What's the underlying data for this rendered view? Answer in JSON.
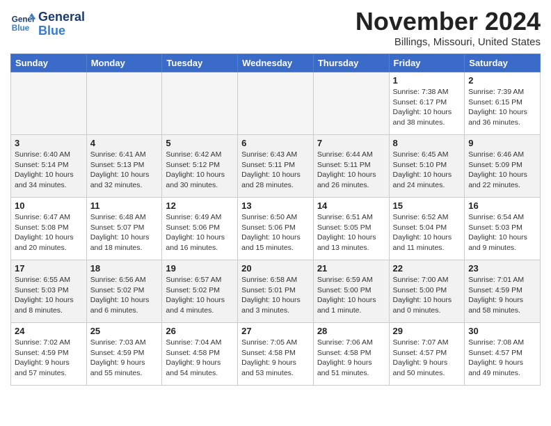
{
  "header": {
    "logo_line1": "General",
    "logo_line2": "Blue",
    "month": "November 2024",
    "location": "Billings, Missouri, United States"
  },
  "weekdays": [
    "Sunday",
    "Monday",
    "Tuesday",
    "Wednesday",
    "Thursday",
    "Friday",
    "Saturday"
  ],
  "weeks": [
    [
      {
        "day": "",
        "info": ""
      },
      {
        "day": "",
        "info": ""
      },
      {
        "day": "",
        "info": ""
      },
      {
        "day": "",
        "info": ""
      },
      {
        "day": "",
        "info": ""
      },
      {
        "day": "1",
        "info": "Sunrise: 7:38 AM\nSunset: 6:17 PM\nDaylight: 10 hours and 38 minutes."
      },
      {
        "day": "2",
        "info": "Sunrise: 7:39 AM\nSunset: 6:15 PM\nDaylight: 10 hours and 36 minutes."
      }
    ],
    [
      {
        "day": "3",
        "info": "Sunrise: 6:40 AM\nSunset: 5:14 PM\nDaylight: 10 hours and 34 minutes."
      },
      {
        "day": "4",
        "info": "Sunrise: 6:41 AM\nSunset: 5:13 PM\nDaylight: 10 hours and 32 minutes."
      },
      {
        "day": "5",
        "info": "Sunrise: 6:42 AM\nSunset: 5:12 PM\nDaylight: 10 hours and 30 minutes."
      },
      {
        "day": "6",
        "info": "Sunrise: 6:43 AM\nSunset: 5:11 PM\nDaylight: 10 hours and 28 minutes."
      },
      {
        "day": "7",
        "info": "Sunrise: 6:44 AM\nSunset: 5:11 PM\nDaylight: 10 hours and 26 minutes."
      },
      {
        "day": "8",
        "info": "Sunrise: 6:45 AM\nSunset: 5:10 PM\nDaylight: 10 hours and 24 minutes."
      },
      {
        "day": "9",
        "info": "Sunrise: 6:46 AM\nSunset: 5:09 PM\nDaylight: 10 hours and 22 minutes."
      }
    ],
    [
      {
        "day": "10",
        "info": "Sunrise: 6:47 AM\nSunset: 5:08 PM\nDaylight: 10 hours and 20 minutes."
      },
      {
        "day": "11",
        "info": "Sunrise: 6:48 AM\nSunset: 5:07 PM\nDaylight: 10 hours and 18 minutes."
      },
      {
        "day": "12",
        "info": "Sunrise: 6:49 AM\nSunset: 5:06 PM\nDaylight: 10 hours and 16 minutes."
      },
      {
        "day": "13",
        "info": "Sunrise: 6:50 AM\nSunset: 5:06 PM\nDaylight: 10 hours and 15 minutes."
      },
      {
        "day": "14",
        "info": "Sunrise: 6:51 AM\nSunset: 5:05 PM\nDaylight: 10 hours and 13 minutes."
      },
      {
        "day": "15",
        "info": "Sunrise: 6:52 AM\nSunset: 5:04 PM\nDaylight: 10 hours and 11 minutes."
      },
      {
        "day": "16",
        "info": "Sunrise: 6:54 AM\nSunset: 5:03 PM\nDaylight: 10 hours and 9 minutes."
      }
    ],
    [
      {
        "day": "17",
        "info": "Sunrise: 6:55 AM\nSunset: 5:03 PM\nDaylight: 10 hours and 8 minutes."
      },
      {
        "day": "18",
        "info": "Sunrise: 6:56 AM\nSunset: 5:02 PM\nDaylight: 10 hours and 6 minutes."
      },
      {
        "day": "19",
        "info": "Sunrise: 6:57 AM\nSunset: 5:02 PM\nDaylight: 10 hours and 4 minutes."
      },
      {
        "day": "20",
        "info": "Sunrise: 6:58 AM\nSunset: 5:01 PM\nDaylight: 10 hours and 3 minutes."
      },
      {
        "day": "21",
        "info": "Sunrise: 6:59 AM\nSunset: 5:00 PM\nDaylight: 10 hours and 1 minute."
      },
      {
        "day": "22",
        "info": "Sunrise: 7:00 AM\nSunset: 5:00 PM\nDaylight: 10 hours and 0 minutes."
      },
      {
        "day": "23",
        "info": "Sunrise: 7:01 AM\nSunset: 4:59 PM\nDaylight: 9 hours and 58 minutes."
      }
    ],
    [
      {
        "day": "24",
        "info": "Sunrise: 7:02 AM\nSunset: 4:59 PM\nDaylight: 9 hours and 57 minutes."
      },
      {
        "day": "25",
        "info": "Sunrise: 7:03 AM\nSunset: 4:59 PM\nDaylight: 9 hours and 55 minutes."
      },
      {
        "day": "26",
        "info": "Sunrise: 7:04 AM\nSunset: 4:58 PM\nDaylight: 9 hours and 54 minutes."
      },
      {
        "day": "27",
        "info": "Sunrise: 7:05 AM\nSunset: 4:58 PM\nDaylight: 9 hours and 53 minutes."
      },
      {
        "day": "28",
        "info": "Sunrise: 7:06 AM\nSunset: 4:58 PM\nDaylight: 9 hours and 51 minutes."
      },
      {
        "day": "29",
        "info": "Sunrise: 7:07 AM\nSunset: 4:57 PM\nDaylight: 9 hours and 50 minutes."
      },
      {
        "day": "30",
        "info": "Sunrise: 7:08 AM\nSunset: 4:57 PM\nDaylight: 9 hours and 49 minutes."
      }
    ]
  ]
}
